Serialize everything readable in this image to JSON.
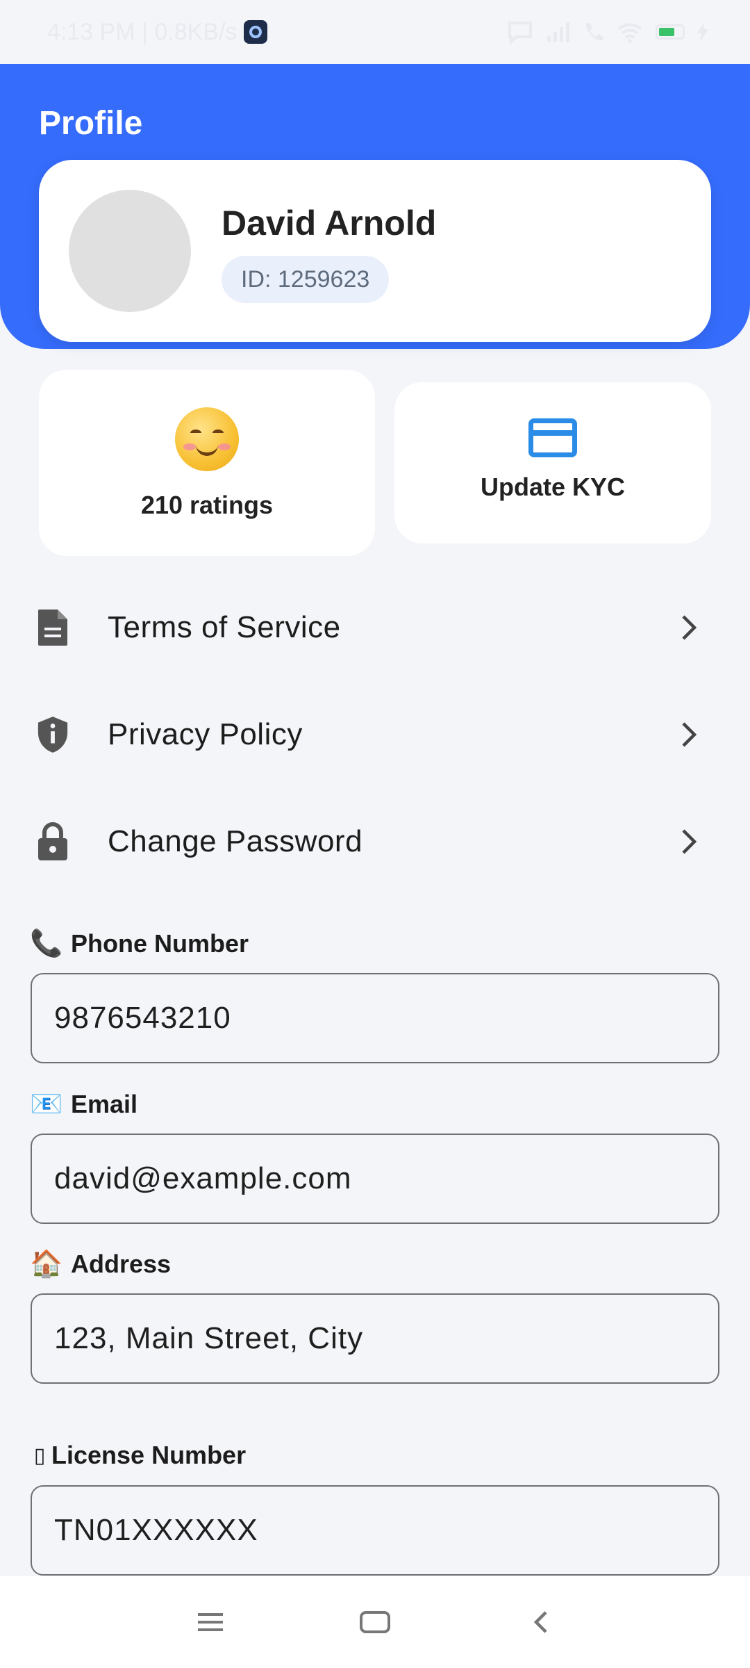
{
  "status_bar": {
    "time_speed": "4:13 PM | 0.8KB/s",
    "battery_level": "1"
  },
  "header": {
    "title": "Profile",
    "accent_color": "#356cfb"
  },
  "profile": {
    "name": "David Arnold",
    "id_label": "ID: 1259623"
  },
  "stats": {
    "ratings_label": "210 ratings",
    "kyc_label": "Update KYC"
  },
  "menu": [
    {
      "label": "Terms of Service",
      "icon": "document-icon"
    },
    {
      "label": "Privacy Policy",
      "icon": "shield-info-icon"
    },
    {
      "label": "Change Password",
      "icon": "lock-icon"
    }
  ],
  "fields": {
    "phone": {
      "emoji": "📞",
      "label": "Phone Number",
      "value": "9876543210"
    },
    "email": {
      "emoji": "📧",
      "label": "Email",
      "value": "david@example.com"
    },
    "address": {
      "emoji": "🏠",
      "label": "Address",
      "value": "123, Main Street, City"
    },
    "license": {
      "emoji": "▯",
      "label": "License Number",
      "value": "TN01XXXXXX"
    }
  }
}
